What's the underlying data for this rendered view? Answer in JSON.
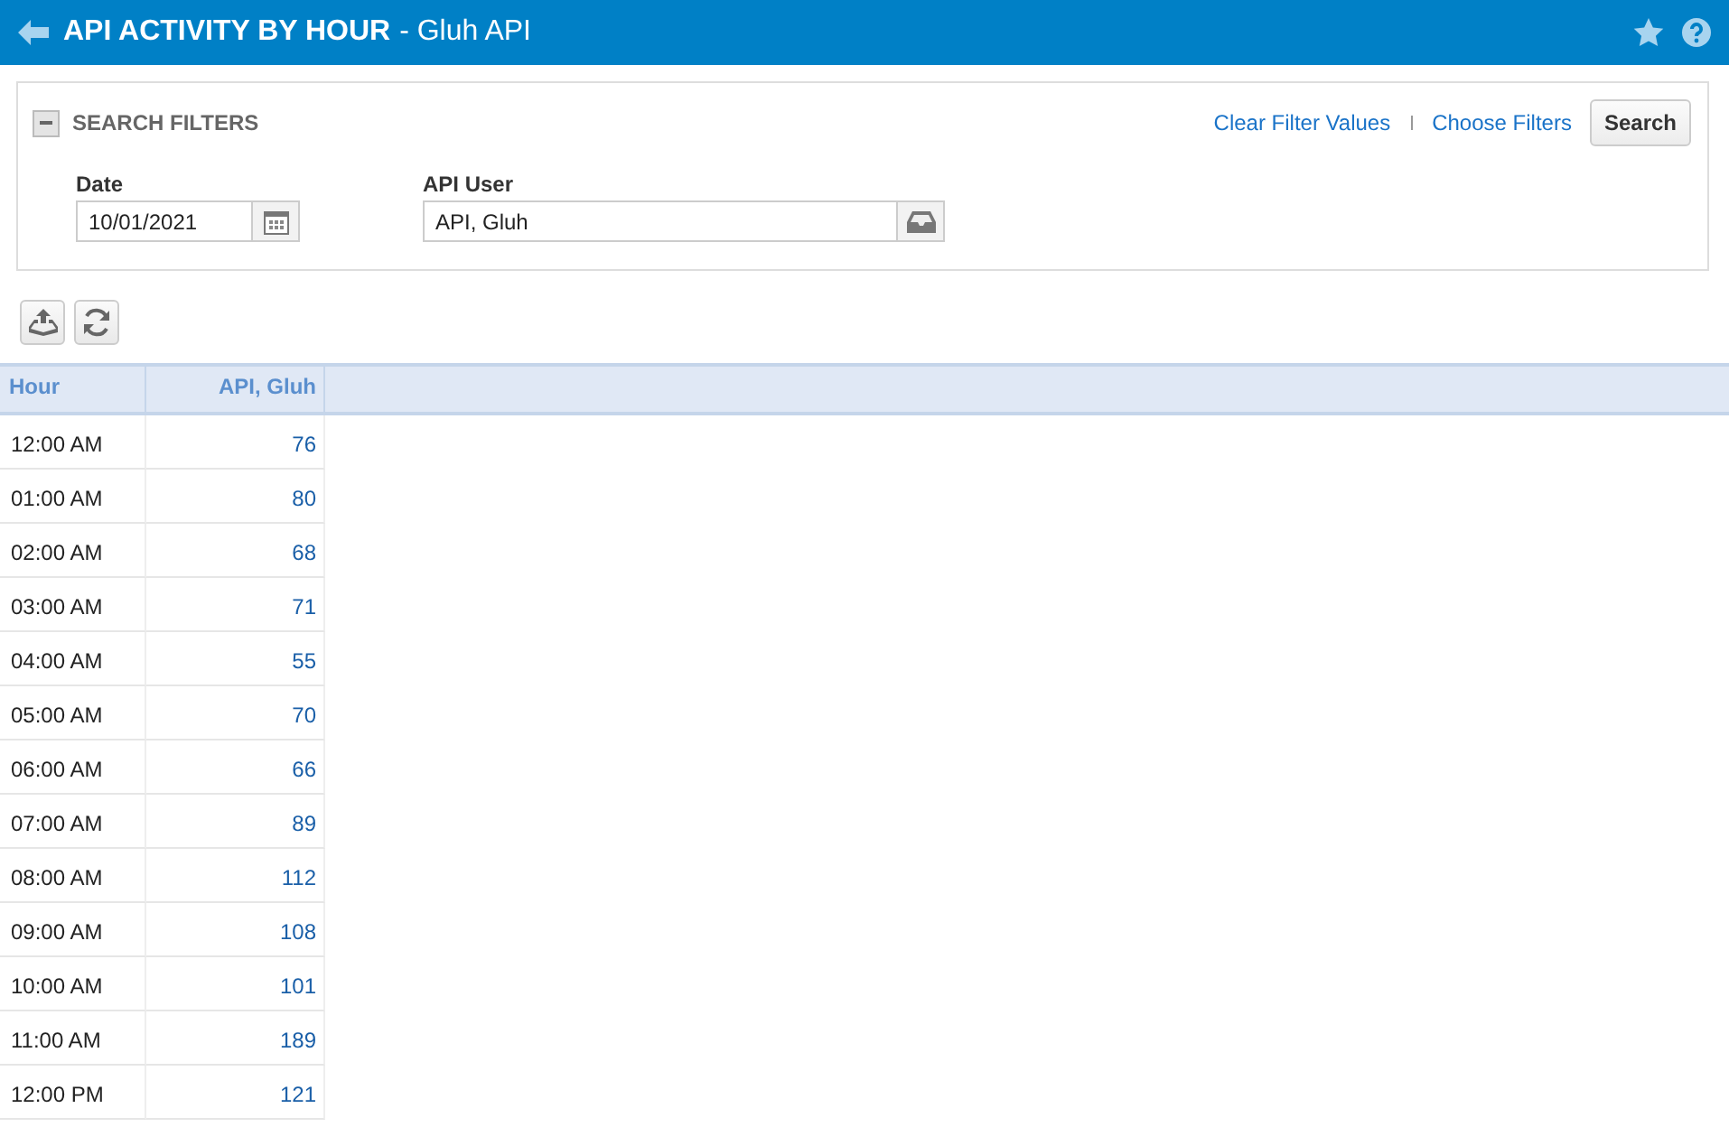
{
  "header": {
    "title": "API ACTIVITY BY HOUR",
    "subtitle": "- Gluh API"
  },
  "filters": {
    "title": "SEARCH FILTERS",
    "expanded": true,
    "links": [
      "Clear Filter Values",
      "Choose Filters"
    ],
    "search_button": "Search",
    "fields": [
      {
        "label": "Date",
        "value": "10/01/2021",
        "kind": "date"
      },
      {
        "label": "API User",
        "value": "API, Gluh",
        "kind": "lookup"
      }
    ]
  },
  "table": {
    "columns": [
      "Hour",
      "API, Gluh"
    ],
    "rows": [
      [
        "12:00 AM",
        "76"
      ],
      [
        "01:00 AM",
        "80"
      ],
      [
        "02:00 AM",
        "68"
      ],
      [
        "03:00 AM",
        "71"
      ],
      [
        "04:00 AM",
        "55"
      ],
      [
        "05:00 AM",
        "70"
      ],
      [
        "06:00 AM",
        "66"
      ],
      [
        "07:00 AM",
        "89"
      ],
      [
        "08:00 AM",
        "112"
      ],
      [
        "09:00 AM",
        "108"
      ],
      [
        "10:00 AM",
        "101"
      ],
      [
        "11:00 AM",
        "189"
      ],
      [
        "12:00 PM",
        "121"
      ]
    ]
  }
}
